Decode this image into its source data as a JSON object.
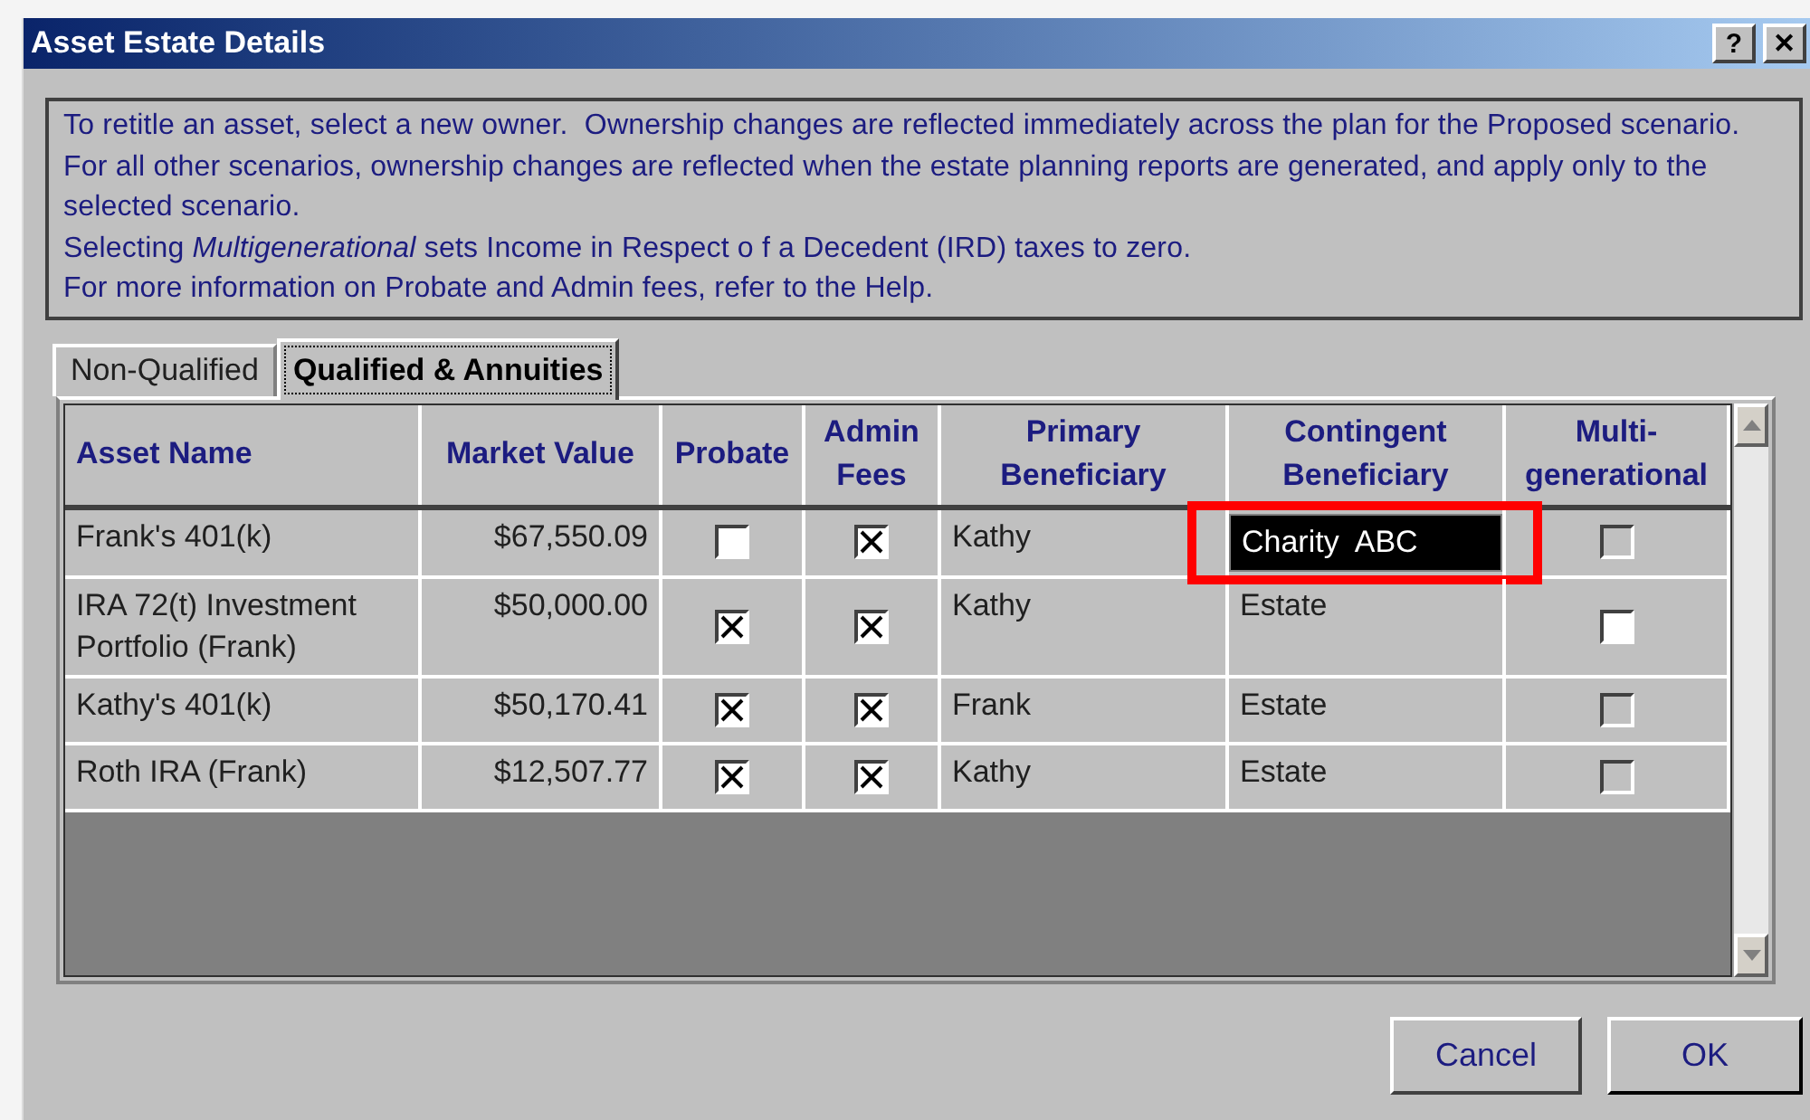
{
  "window": {
    "title": "Asset Estate Details"
  },
  "info": [
    "To retitle an asset, select a new owner.  Ownership changes are reflected immediately across the plan for the Proposed scenario.  For all other scenarios, ownership changes are reflected when the estate planning reports are generated, and apply only to the selected scenario.",
    "Selecting *Multigenerational* sets Income in Respect o f a Decedent (IRD) taxes to zero.",
    "For more information on Probate and Admin fees, refer to the Help."
  ],
  "tabs": [
    {
      "label": "Non-Qualified",
      "selected": false
    },
    {
      "label": "Qualified & Annuities",
      "selected": true
    }
  ],
  "table": {
    "columns": [
      "Asset Name",
      "Market Value",
      "Probate",
      "Admin Fees",
      "Primary Beneficiary",
      "Contingent Beneficiary",
      "Multi-generational"
    ],
    "rows": [
      {
        "asset_name": "Frank's 401(k)",
        "market_value": "$67,550.09",
        "probate": false,
        "admin_fees": true,
        "primary": "Kathy",
        "contingent": "Charity  ABC",
        "contingent_selected": true,
        "multigenerational": false,
        "multigenerational_disabled": true
      },
      {
        "asset_name": "IRA 72(t) Investment Portfolio (Frank)",
        "market_value": "$50,000.00",
        "probate": true,
        "admin_fees": true,
        "primary": "Kathy",
        "contingent": "Estate",
        "contingent_selected": false,
        "multigenerational": false,
        "multigenerational_disabled": false
      },
      {
        "asset_name": "Kathy's 401(k)",
        "market_value": "$50,170.41",
        "probate": true,
        "admin_fees": true,
        "primary": "Frank",
        "contingent": "Estate",
        "contingent_selected": false,
        "multigenerational": false,
        "multigenerational_disabled": true
      },
      {
        "asset_name": "Roth IRA (Frank)",
        "market_value": "$12,507.77",
        "probate": true,
        "admin_fees": true,
        "primary": "Kathy",
        "contingent": "Estate",
        "contingent_selected": false,
        "multigenerational": false,
        "multigenerational_disabled": true
      }
    ]
  },
  "title_buttons": [
    "?",
    "✕"
  ],
  "buttons": [
    "Cancel",
    "OK"
  ]
}
